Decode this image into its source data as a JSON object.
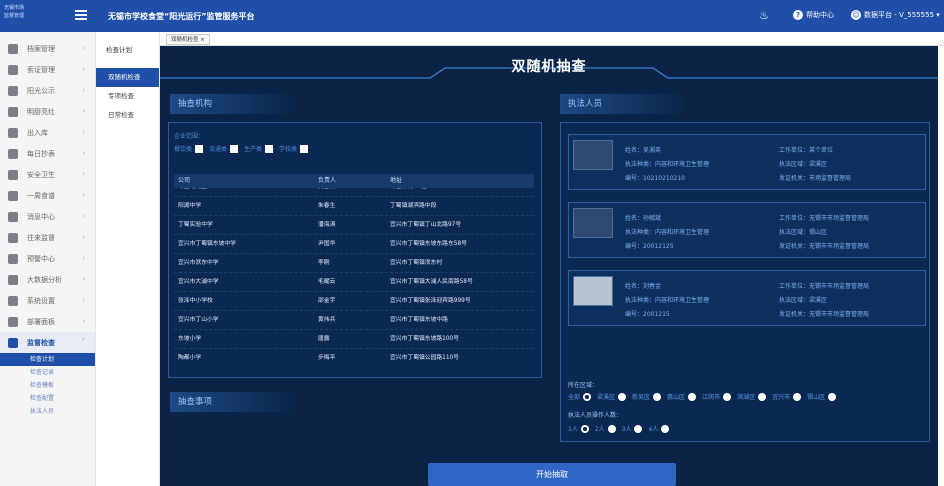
{
  "header": {
    "logo_line1": "无锡市场",
    "logo_line2": "监督管理",
    "title": "无锡市学校食堂“阳光运行”监管服务平台",
    "help_label": "帮助中心",
    "user_label": "数据平台 - V_555555"
  },
  "sidebar": {
    "items": [
      {
        "label": "档案管理",
        "icon": "archive-icon"
      },
      {
        "label": "索证管理",
        "icon": "document-icon"
      },
      {
        "label": "阳光公示",
        "icon": "notice-icon"
      },
      {
        "label": "明厨亮灶",
        "icon": "camera-icon"
      },
      {
        "label": "出入库",
        "icon": "warehouse-icon"
      },
      {
        "label": "每日抄表",
        "icon": "meter-icon"
      },
      {
        "label": "安全卫生",
        "icon": "shield-icon"
      },
      {
        "label": "一周食谱",
        "icon": "menu-icon"
      },
      {
        "label": "消息中心",
        "icon": "message-icon"
      },
      {
        "label": "往来监督",
        "icon": "supervise-icon"
      },
      {
        "label": "预警中心",
        "icon": "alert-icon"
      },
      {
        "label": "大数据分析",
        "icon": "chart-icon"
      },
      {
        "label": "系统设置",
        "icon": "settings-icon"
      },
      {
        "label": "部署面板",
        "icon": "deploy-icon"
      },
      {
        "label": "监督检查",
        "icon": "inspect-icon"
      }
    ],
    "subitems": [
      "检查计划",
      "检查记录",
      "检查模板",
      "检查配置",
      "执法人员"
    ]
  },
  "subnav": {
    "head": "检查计划",
    "items": [
      "双随机检查",
      "专项检查",
      "日常检查"
    ]
  },
  "tab": {
    "label": "双随机检查 ×"
  },
  "main": {
    "title": "双随机抽查",
    "section_agency": "抽查机构",
    "section_staff": "执法人员",
    "section_items": "抽查事项",
    "filter_label": "企业范围：",
    "filter_options": [
      "餐饮类",
      "流通类",
      "生产类",
      "学校类"
    ],
    "table_headers": [
      "公司",
      "负责人",
      "地址"
    ],
    "table_rows": [
      [
        "绿苗幼儿园",
        "吴春燕",
        "绿苗新村12幢"
      ],
      [
        "阳湖中学",
        "朱春生",
        "丁蜀镇湖滨路中段"
      ],
      [
        "丁蜀实验中学",
        "潘海涛",
        "宜兴市丁蜀镇丁山北路97号"
      ],
      [
        "宜兴市丁蜀镇东坡中学",
        "尹国华",
        "宜兴市丁蜀镇东坡东路东58号"
      ],
      [
        "宜兴市洑东中学",
        "李刚",
        "宜兴市丁蜀镇洑东村"
      ],
      [
        "宜兴市大浦中学",
        "毛耀云",
        "宜兴市丁蜀镇大浦人民南路58号"
      ],
      [
        "张泽中小学校",
        "邵金宇",
        "宜兴市丁蜀镇张泽迎宾路999号"
      ],
      [
        "宜兴市丁山小学",
        "黄伟兵",
        "宜兴市丁蜀镇东坡中路"
      ],
      [
        "东坡小学",
        "唐露",
        "宜兴市丁蜀镇东坡路100号"
      ],
      [
        "陶都小学",
        "步梅平",
        "宜兴市丁蜀镇公园路110号"
      ]
    ],
    "staff": [
      {
        "name": "姓名：吴湘英",
        "type": "执法种类：内容和环境卫生管理",
        "id": "编号：10210210210",
        "unit": "工作单位：某个单位",
        "area": "执法区域：梁溪区",
        "org": "发证机关：市场监督管理局"
      },
      {
        "name": "姓名：孙毓斌",
        "type": "执法种类：内容和环境卫生管理",
        "id": "编号：20012125",
        "unit": "工作单位：无锡市市场监督管理局",
        "area": "执法区域：锡山区",
        "org": "发证机关：无锡市市场监督管理局"
      },
      {
        "name": "姓名：刘春金",
        "type": "执法种类：内容和环境卫生管理",
        "id": "编号：2001215",
        "unit": "工作单位：无锡市市场监督管理局",
        "area": "执法区域：梁溪区",
        "org": "发证机关：无锡市市场监督管理局"
      }
    ],
    "region_label": "所在区域：",
    "regions": [
      "全部",
      "梁溪区",
      "新吴区",
      "惠山区",
      "江阴市",
      "滨湖区",
      "宜兴市",
      "锡山区"
    ],
    "count_label": "执法人员操作人数：",
    "counts": [
      "1人",
      "2人",
      "3人",
      "4人"
    ],
    "start_button": "开始抽取"
  }
}
